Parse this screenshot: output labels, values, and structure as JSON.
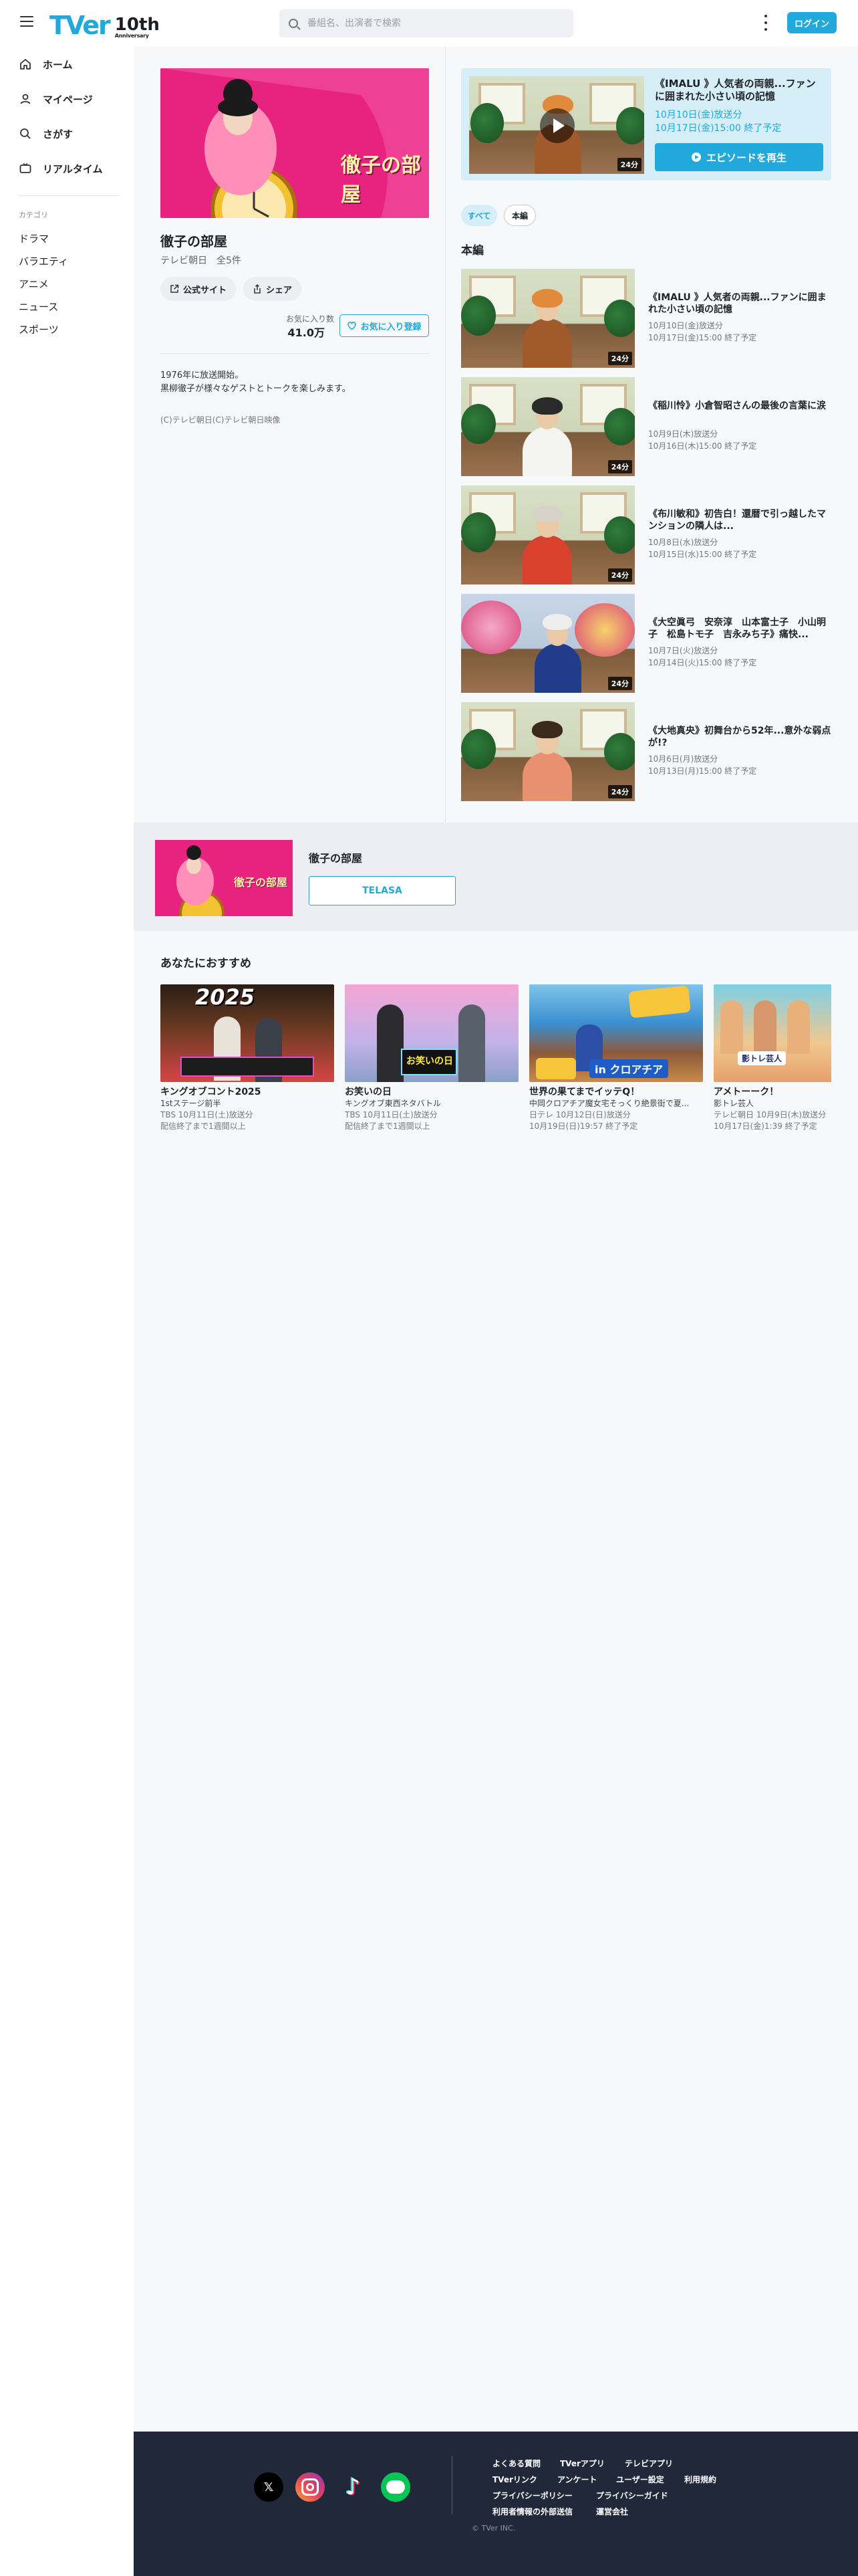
{
  "header": {
    "search_placeholder": "番組名、出演者で検索",
    "login_label": "ログイン",
    "logo_text": "TVer",
    "logo_badge": "10th",
    "logo_badge_sub": "Anniversary"
  },
  "sidebar": {
    "nav": [
      "ホーム",
      "マイページ",
      "さがす",
      "リアルタイム"
    ],
    "category_title": "カテゴリ",
    "categories": [
      "ドラマ",
      "バラエティ",
      "アニメ",
      "ニュース",
      "スポーツ"
    ]
  },
  "show": {
    "title": "徹子の部屋",
    "meta": "テレビ朝日　全5件",
    "official_site_label": "公式サイト",
    "share_label": "シェア",
    "fav_label": "お気に入り数",
    "fav_count": "41.0万",
    "fav_button": "お気に入り登録",
    "description": "1976年に放送開始。\n黒柳徹子が様々なゲストとトークを楽しみます。",
    "copyright": "(C)テレビ朝日(C)テレビ朝日映像",
    "hero_text": "徹子の部屋"
  },
  "featured": {
    "title": "《IMALU 》人気者の両親...ファンに囲まれた小さい頃の記憶",
    "date1": "10月10日(金)放送分",
    "date2": "10月17日(金)15:00 終了予定",
    "play_label": "エピソードを再生",
    "duration": "24分"
  },
  "tabs": [
    "すべて",
    "本編"
  ],
  "section_title": "本編",
  "episodes": [
    {
      "title": "《IMALU 》人気者の両親...ファンに囲まれた小さい頃の記憶",
      "date1": "10月10日(金)放送分",
      "date2": "10月17日(金)15:00 終了予定",
      "duration": "24分"
    },
    {
      "title": "《稲川怜》小倉智昭さんの最後の言葉に涙",
      "date1": "10月9日(木)放送分",
      "date2": "10月16日(木)15:00 終了予定",
      "duration": "24分"
    },
    {
      "title": "《布川敏和》初告白！還暦で引っ越したマンションの隣人は...",
      "date1": "10月8日(水)放送分",
      "date2": "10月15日(水)15:00 終了予定",
      "duration": "24分"
    },
    {
      "title": "《大空眞弓　安奈淳　山本富士子　小山明子　松島トモ子　吉永みち子》痛快...",
      "date1": "10月7日(火)放送分",
      "date2": "10月14日(火)15:00 終了予定",
      "duration": "24分"
    },
    {
      "title": "《大地真央》初舞台から52年...意外な弱点が!?",
      "date1": "10月6日(月)放送分",
      "date2": "10月13日(月)15:00 終了予定",
      "duration": "24分"
    }
  ],
  "telasa": {
    "title": "徹子の部屋",
    "button": "TELASA"
  },
  "recommend": {
    "title": "あなたにおすすめ",
    "cards": [
      {
        "title": "キングオブコント2025",
        "sub": "1stステージ前半",
        "meta1": "TBS 10月11日(土)放送分",
        "meta2": "配信終了まで1週間以上",
        "thumb_text": "2025"
      },
      {
        "title": "お笑いの日",
        "sub": "キングオブ東西ネタバトル",
        "meta1": "TBS 10月11日(土)放送分",
        "meta2": "配信終了まで1週間以上",
        "thumb_text": "お笑いの日"
      },
      {
        "title": "世界の果てまでイッテQ！",
        "sub": "中岡クロアチア魔女宅そっくり絶景街で夏...",
        "meta1": "日テレ 10月12日(日)放送分",
        "meta2": "10月19日(日)19:57 終了予定",
        "thumb_text": "in クロアチア"
      },
      {
        "title": "アメトーーク！",
        "sub": "影トレ芸人",
        "meta1": "テレビ朝日 10月9日(木)放送分",
        "meta2": "10月17日(金)1:39 終了予定",
        "thumb_text": "影トレ芸人"
      }
    ]
  },
  "footer": {
    "links_row1": [
      "よくある質問",
      "TVerアプリ",
      "テレビアプリ"
    ],
    "links_row2": [
      "TVerリンク",
      "アンケート",
      "ユーザー設定",
      "利用規約"
    ],
    "links_row3": [
      "プライバシーポリシー",
      "プライバシーガイド"
    ],
    "links_row4": [
      "利用者情報の外部送信",
      "運営会社"
    ],
    "copyright": "© TVer INC."
  },
  "colors": {
    "accent": "#21a9dc",
    "footer_bg": "#202839",
    "hero_pink": "#f52d9b"
  }
}
